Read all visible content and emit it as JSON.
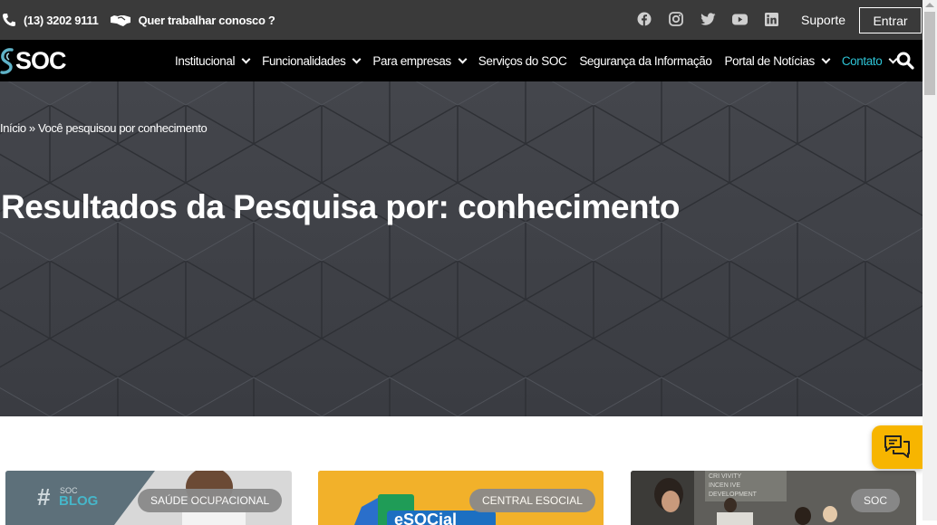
{
  "topbar": {
    "phone": "(13) 3202 9111",
    "work_link": "Quer trabalhar conosco ?",
    "social": [
      "facebook-icon",
      "instagram-icon",
      "twitter-icon",
      "youtube-icon",
      "linkedin-icon"
    ],
    "suporte": "Suporte",
    "entrar": "Entrar"
  },
  "nav": {
    "logo": "SOC",
    "items": [
      {
        "label": "Institucional",
        "dropdown": true
      },
      {
        "label": "Funcionalidades",
        "dropdown": true
      },
      {
        "label": "Para empresas",
        "dropdown": true
      },
      {
        "label": "Serviços do SOC",
        "dropdown": false
      },
      {
        "label": "Segurança da Informação",
        "dropdown": false
      },
      {
        "label": "Portal de Notícias",
        "dropdown": true
      },
      {
        "label": "Contato",
        "dropdown": true,
        "active": true
      }
    ]
  },
  "hero": {
    "breadcrumb_home": "Início",
    "breadcrumb_sep": " » ",
    "breadcrumb_current": "Você pesquisou por conhecimento",
    "title": "Resultados da Pesquisa por: conhecimento"
  },
  "cards": [
    {
      "tag": "SAÚDE OCUPACIONAL",
      "image_text": "# SOC BLOG"
    },
    {
      "tag": "CENTRAL ESOCIAL",
      "image_text": "eSOCial"
    },
    {
      "tag": "SOC",
      "image_text": ""
    }
  ],
  "colors": {
    "topbar": "#3a3a3a",
    "navbar": "#000000",
    "active": "#2ec4d6",
    "chat": "#f7b500"
  }
}
